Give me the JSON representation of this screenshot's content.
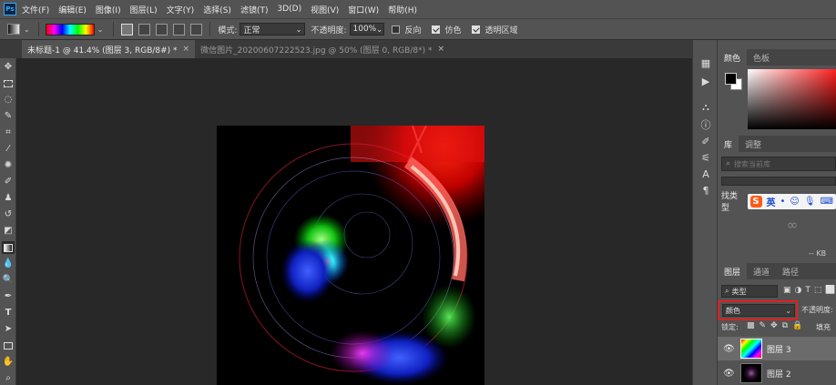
{
  "menubar": {
    "logo": "Ps",
    "items": [
      "文件(F)",
      "编辑(E)",
      "图像(I)",
      "图层(L)",
      "文字(Y)",
      "选择(S)",
      "滤镜(T)",
      "3D(D)",
      "视图(V)",
      "窗口(W)",
      "帮助(H)"
    ]
  },
  "options": {
    "mode_label": "模式:",
    "mode_value": "正常",
    "opacity_label": "不透明度:",
    "opacity_value": "100%",
    "reverse_label": "反向",
    "dither_label": "仿色",
    "transparency_label": "透明区域"
  },
  "tabs": [
    {
      "label": "未标题-1 @ 41.4% (图层 3, RGB/8#) *",
      "close": "×"
    },
    {
      "label": "微信图片_20200607222523.jpg @ 50% (图层 0, RGB/8*) *",
      "close": "×"
    }
  ],
  "panels": {
    "color_tabs": [
      "颜色",
      "色板"
    ],
    "library_tabs": [
      "库",
      "调整"
    ],
    "library_search_placeholder": "搜索当前库",
    "ime_prefix": "找类型",
    "ime_label": "英",
    "kb_label": "-- KB",
    "layers_tabs": [
      "图层",
      "通道",
      "路径"
    ],
    "kind_label": "类型",
    "blend_mode": "颜色",
    "opacity_label": "不透明度:",
    "lock_label": "锁定:",
    "fill_label": "填充",
    "layers": [
      {
        "name": "图层 3"
      },
      {
        "name": "图层 2"
      }
    ]
  },
  "colors": {
    "fg": "#000000",
    "bg": "#ffffff",
    "highlight": "#e02020"
  }
}
